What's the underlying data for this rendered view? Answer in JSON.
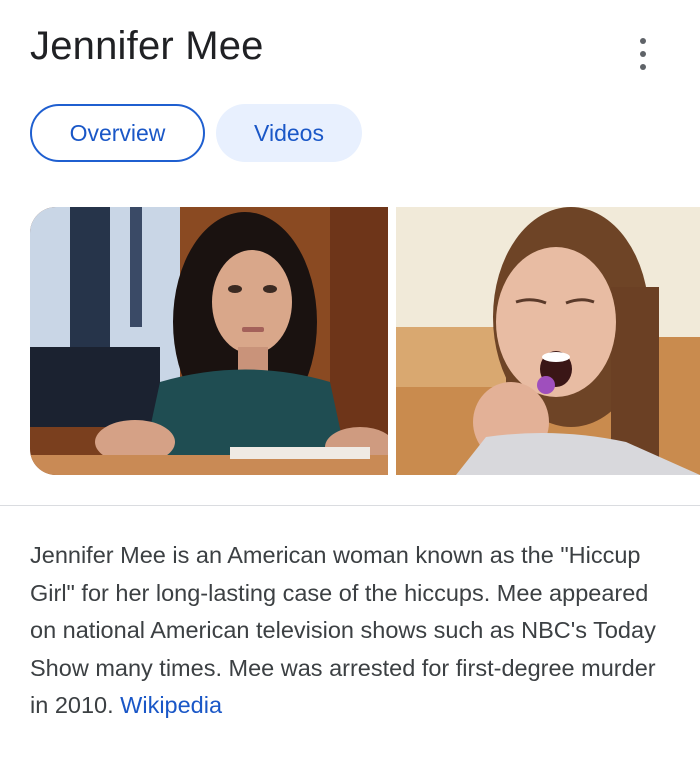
{
  "panel": {
    "title": "Jennifer Mee",
    "more_icon": "more-vert-icon"
  },
  "tabs": [
    {
      "label": "Overview",
      "selected": true
    },
    {
      "label": "Videos",
      "selected": false
    }
  ],
  "description": {
    "text": "Jennifer Mee is an American woman known as the \"Hiccup Girl\" for her long-lasting case of the hiccups. Mee appeared on national American television shows such as NBC's Today Show many times. Mee was arrested for first-degree murder in 2010.",
    "source_link": "Wikipedia"
  },
  "colors": {
    "title": "#202124",
    "text": "#3c4043",
    "link": "#1a57c7",
    "chip_border": "#1f5fd0",
    "chip_fill": "#e8f0fe",
    "divider": "#dadce0"
  }
}
